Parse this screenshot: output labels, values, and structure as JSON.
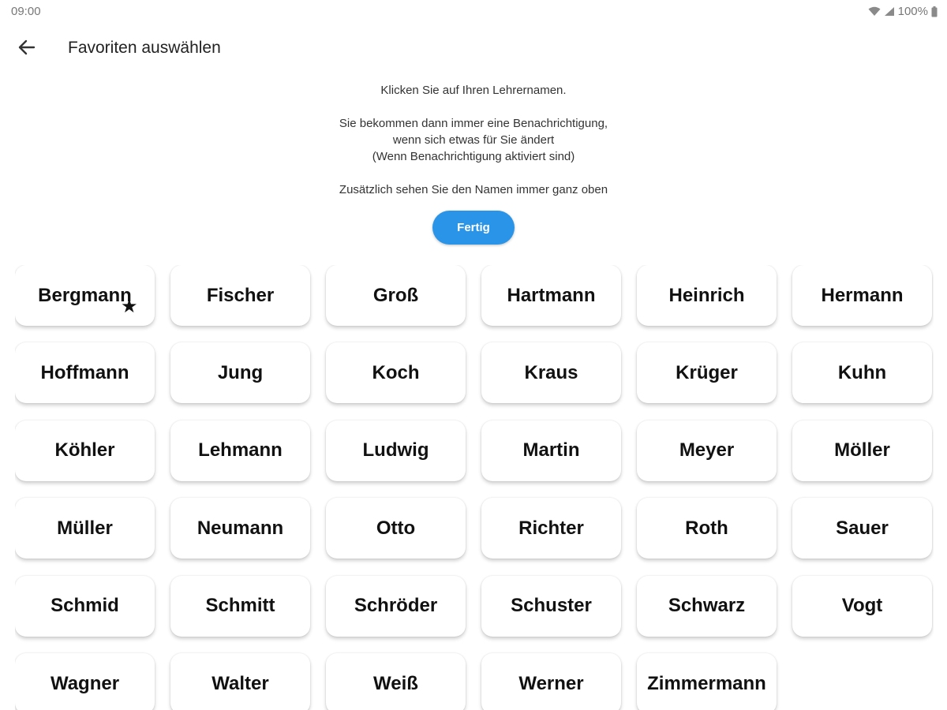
{
  "status_bar": {
    "time": "09:00",
    "battery": "100%",
    "icons": [
      "wifi-icon",
      "signal-icon",
      "battery-icon"
    ]
  },
  "app_bar": {
    "back_icon": "arrow-left-icon",
    "title": "Favoriten auswählen"
  },
  "instructions": {
    "line1": "Klicken Sie auf Ihren Lehrernamen.",
    "line2": "Sie bekommen dann immer eine Benachrichtigung,",
    "line3": "wenn sich etwas für Sie ändert",
    "line4": "(Wenn Benachrichtigung aktiviert sind)",
    "line5": "Zusätzlich sehen Sie den Namen immer ganz oben"
  },
  "done_button": {
    "label": "Fertig",
    "color": "#2a94e8"
  },
  "teachers": [
    {
      "name": "Bergmann",
      "favorite": true
    },
    {
      "name": "Fischer"
    },
    {
      "name": "Groß"
    },
    {
      "name": "Hartmann"
    },
    {
      "name": "Heinrich"
    },
    {
      "name": "Hermann"
    },
    {
      "name": "Hoffmann"
    },
    {
      "name": "Jung"
    },
    {
      "name": "Koch"
    },
    {
      "name": "Kraus"
    },
    {
      "name": "Krüger"
    },
    {
      "name": "Kuhn"
    },
    {
      "name": "Köhler"
    },
    {
      "name": "Lehmann"
    },
    {
      "name": "Ludwig"
    },
    {
      "name": "Martin"
    },
    {
      "name": "Meyer"
    },
    {
      "name": "Möller"
    },
    {
      "name": "Müller"
    },
    {
      "name": "Neumann"
    },
    {
      "name": "Otto"
    },
    {
      "name": "Richter"
    },
    {
      "name": "Roth"
    },
    {
      "name": "Sauer"
    },
    {
      "name": "Schmid"
    },
    {
      "name": "Schmitt"
    },
    {
      "name": "Schröder"
    },
    {
      "name": "Schuster"
    },
    {
      "name": "Schwarz"
    },
    {
      "name": "Vogt"
    },
    {
      "name": "Wagner"
    },
    {
      "name": "Walter"
    },
    {
      "name": "Weiß"
    },
    {
      "name": "Werner"
    },
    {
      "name": "Zimmermann"
    }
  ]
}
